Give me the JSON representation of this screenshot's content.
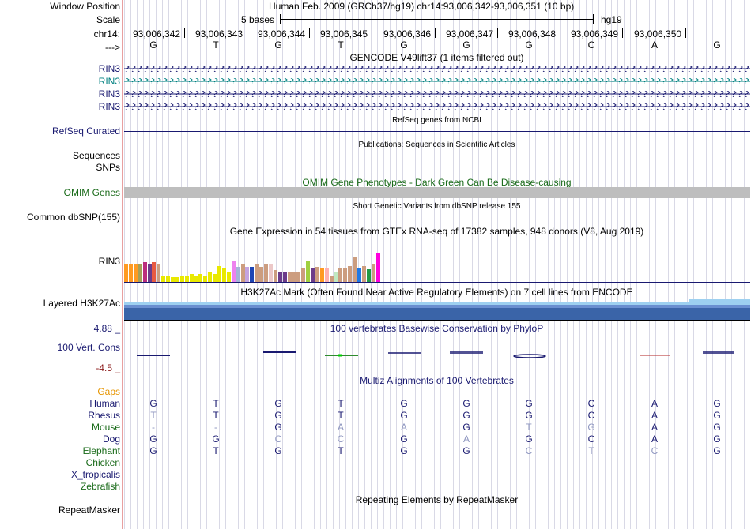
{
  "labels": {
    "window_position": "Window Position",
    "scale": "Scale",
    "chrom": "chr14:",
    "strand_arrow": "--->",
    "rin3": "RIN3",
    "refseq": "RefSeq Curated",
    "sequences": "Sequences",
    "snps": "SNPs",
    "omim": "OMIM Genes",
    "common_dbsnp": "Common dbSNP(155)",
    "gtex_gene": "RIN3",
    "h3k27ac": "Layered H3K27Ac",
    "phylop_max": "4.88 _",
    "phylop_name": "100 Vert. Cons",
    "phylop_min": "-4.5 _",
    "gaps": "Gaps",
    "repeatmasker": "RepeatMasker"
  },
  "header": {
    "position_text": "Human Feb. 2009 (GRCh37/hg19)   chr14:93,006,342-93,006,351 (10 bp)",
    "scale_text": "5 bases",
    "assembly": "hg19",
    "coords": [
      "93,006,342",
      "93,006,343",
      "93,006,344",
      "93,006,345",
      "93,006,346",
      "93,006,347",
      "93,006,348",
      "93,006,349",
      "93,006,350"
    ],
    "bases": [
      "G",
      "T",
      "G",
      "T",
      "G",
      "G",
      "G",
      "C",
      "A",
      "G"
    ]
  },
  "titles": {
    "gencode": "GENCODE V49lift37 (1 items filtered out)",
    "refseq": "RefSeq genes from NCBI",
    "publications": "Publications: Sequences in Scientific Articles",
    "omim": "OMIM Gene Phenotypes - Dark Green Can Be Disease-causing",
    "dbsnp": "Short Genetic Variants from dbSNP release 155",
    "gtex": "Gene Expression in 54 tissues from GTEx RNA-seq of 17382 samples, 948 donors (V8, Aug 2019)",
    "h3k27ac": "H3K27Ac Mark (Often Found Near Active Regulatory Elements) on 7 cell lines from ENCODE",
    "phylop": "100 vertebrates Basewise Conservation by PhyloP",
    "multiz": "Multiz Alignments of 100 Vertebrates",
    "repeatmasker": "Repeating Elements by RepeatMasker"
  },
  "gtex_bars": [
    {
      "color": "#ff9a22",
      "level": 0.36
    },
    {
      "color": "#ff9a22",
      "level": 0.36
    },
    {
      "color": "#ff9a22",
      "level": 0.36
    },
    {
      "color": "#a5a05a",
      "level": 0.36
    },
    {
      "color": "#bb2d7d",
      "level": 0.42
    },
    {
      "color": "#6b3b8a",
      "level": 0.38
    },
    {
      "color": "#e85a42",
      "level": 0.41
    },
    {
      "color": "#cc9d7f",
      "level": 0.36
    },
    {
      "color": "#e9e900",
      "level": 0.13
    },
    {
      "color": "#e9e900",
      "level": 0.13
    },
    {
      "color": "#e9e900",
      "level": 0.1
    },
    {
      "color": "#e9e900",
      "level": 0.1
    },
    {
      "color": "#e9e900",
      "level": 0.13
    },
    {
      "color": "#e9e900",
      "level": 0.14
    },
    {
      "color": "#e9e900",
      "level": 0.16
    },
    {
      "color": "#e9e900",
      "level": 0.13
    },
    {
      "color": "#e9e900",
      "level": 0.16
    },
    {
      "color": "#e9e900",
      "level": 0.13
    },
    {
      "color": "#e9e900",
      "level": 0.2
    },
    {
      "color": "#e9e900",
      "level": 0.16
    },
    {
      "color": "#e9e900",
      "level": 0.34
    },
    {
      "color": "#e9e900",
      "level": 0.3
    },
    {
      "color": "#e9e900",
      "level": 0.2
    },
    {
      "color": "#ee82ee",
      "level": 0.43
    },
    {
      "color": "#a5b4d8",
      "level": 0.32
    },
    {
      "color": "#cc9d7f",
      "level": 0.36
    },
    {
      "color": "#c4a4e0",
      "level": 0.32
    },
    {
      "color": "#1e46b4",
      "level": 0.32
    },
    {
      "color": "#cc9d7f",
      "level": 0.38
    },
    {
      "color": "#cc9d7f",
      "level": 0.32
    },
    {
      "color": "#cc9d7f",
      "level": 0.36
    },
    {
      "color": "#ecc8c8",
      "level": 0.38
    },
    {
      "color": "#cc9d7f",
      "level": 0.25
    },
    {
      "color": "#6b3b8a",
      "level": 0.22
    },
    {
      "color": "#6b3b8a",
      "level": 0.22
    },
    {
      "color": "#cc9d7f",
      "level": 0.2
    },
    {
      "color": "#cc9d7f",
      "level": 0.2
    },
    {
      "color": "#cc9d7f",
      "level": 0.2
    },
    {
      "color": "#cc9d7f",
      "level": 0.28
    },
    {
      "color": "#a0d040",
      "level": 0.44
    },
    {
      "color": "#6b3b8a",
      "level": 0.28
    },
    {
      "color": "#cc9d7f",
      "level": 0.32
    },
    {
      "color": "#ff9a22",
      "level": 0.3
    },
    {
      "color": "#ffb0b0",
      "level": 0.28
    },
    {
      "color": "#cc9d7f",
      "level": 0.12
    },
    {
      "color": "#c0e8c0",
      "level": 0.2
    },
    {
      "color": "#cc9d7f",
      "level": 0.28
    },
    {
      "color": "#cc9d7f",
      "level": 0.3
    },
    {
      "color": "#cc9d7f",
      "level": 0.34
    },
    {
      "color": "#cc9d7f",
      "level": 0.52
    },
    {
      "color": "#1e78e6",
      "level": 0.3
    },
    {
      "color": "#cc9d7f",
      "level": 0.34
    },
    {
      "color": "#229944",
      "level": 0.27
    },
    {
      "color": "#cc9d7f",
      "level": 0.39
    },
    {
      "color": "#ff00dd",
      "level": 0.6
    }
  ],
  "species": [
    {
      "name": "Human",
      "color": "#191970",
      "bases": [
        "G",
        "T",
        "G",
        "T",
        "G",
        "G",
        "G",
        "C",
        "A",
        "G"
      ],
      "match": [
        1,
        1,
        1,
        1,
        1,
        1,
        1,
        1,
        1,
        1
      ]
    },
    {
      "name": "Rhesus",
      "color": "#191970",
      "bases": [
        "T",
        "T",
        "G",
        "T",
        "G",
        "G",
        "G",
        "C",
        "A",
        "G"
      ],
      "match": [
        0,
        1,
        1,
        1,
        1,
        1,
        1,
        1,
        1,
        1
      ]
    },
    {
      "name": "Mouse",
      "color": "#1a6b1a",
      "bases": [
        "-",
        "-",
        "G",
        "A",
        "A",
        "G",
        "T",
        "G",
        "A",
        "G"
      ],
      "match": [
        0,
        0,
        1,
        0,
        0,
        1,
        0,
        0,
        1,
        1
      ]
    },
    {
      "name": "Dog",
      "color": "#191970",
      "bases": [
        "G",
        "G",
        "C",
        "C",
        "G",
        "A",
        "G",
        "C",
        "A",
        "G"
      ],
      "match": [
        1,
        1,
        0,
        0,
        1,
        0,
        1,
        1,
        1,
        1
      ]
    },
    {
      "name": "Elephant",
      "color": "#1a6b1a",
      "bases": [
        "G",
        "T",
        "G",
        "T",
        "G",
        "G",
        "C",
        "T",
        "C",
        "G"
      ],
      "match": [
        1,
        1,
        1,
        1,
        1,
        1,
        0,
        0,
        0,
        1
      ]
    },
    {
      "name": "Chicken",
      "color": "#1a6b1a",
      "bases": [],
      "match": []
    },
    {
      "name": "X_tropicalis",
      "color": "#191970",
      "bases": [],
      "match": []
    },
    {
      "name": "Zebrafish",
      "color": "#1a6b1a",
      "bases": [],
      "match": []
    }
  ],
  "colors": {
    "track_label_blue": "#191970",
    "omim_green": "#1a6b1a",
    "gaps_orange": "#e69500",
    "rin3_highlight": "#008080",
    "omim_bar": "#bebebe",
    "h3k27ac_blue": "#3a64a8",
    "phylop_neg": "#8b1a1a"
  }
}
